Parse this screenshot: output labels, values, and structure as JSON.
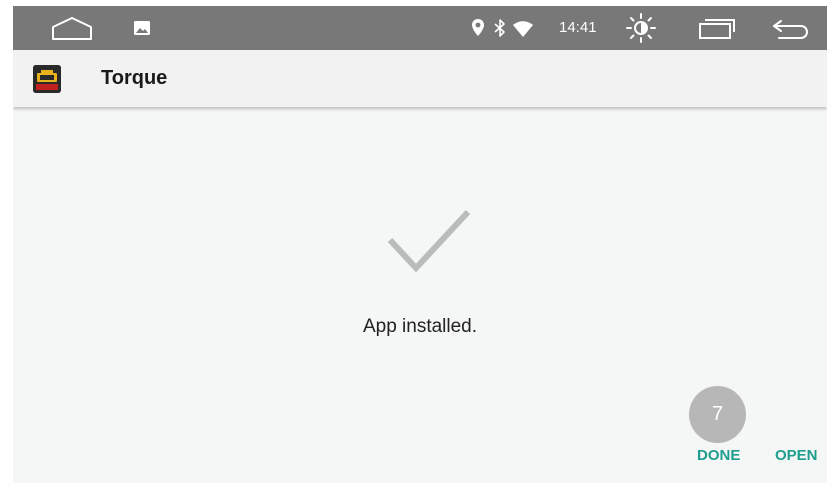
{
  "status_bar": {
    "time": "14:41",
    "icons": [
      "home-icon",
      "gallery-icon",
      "location-icon",
      "bluetooth-icon",
      "wifi-icon",
      "brightness-icon",
      "recents-icon",
      "back-icon"
    ]
  },
  "header": {
    "app_name": "Torque",
    "icon": "torque-app-icon"
  },
  "content": {
    "icon": "checkmark-icon",
    "message": "App installed."
  },
  "countdown": {
    "value": "7"
  },
  "actions": {
    "done_label": "DONE",
    "open_label": "OPEN"
  },
  "colors": {
    "status_bar": "#787878",
    "header": "#f2f2f2",
    "background": "#f5f6f6",
    "accent": "#1e9e8e",
    "checkmark": "#b9bcbc",
    "countdown_badge": "#b7b7b7"
  }
}
